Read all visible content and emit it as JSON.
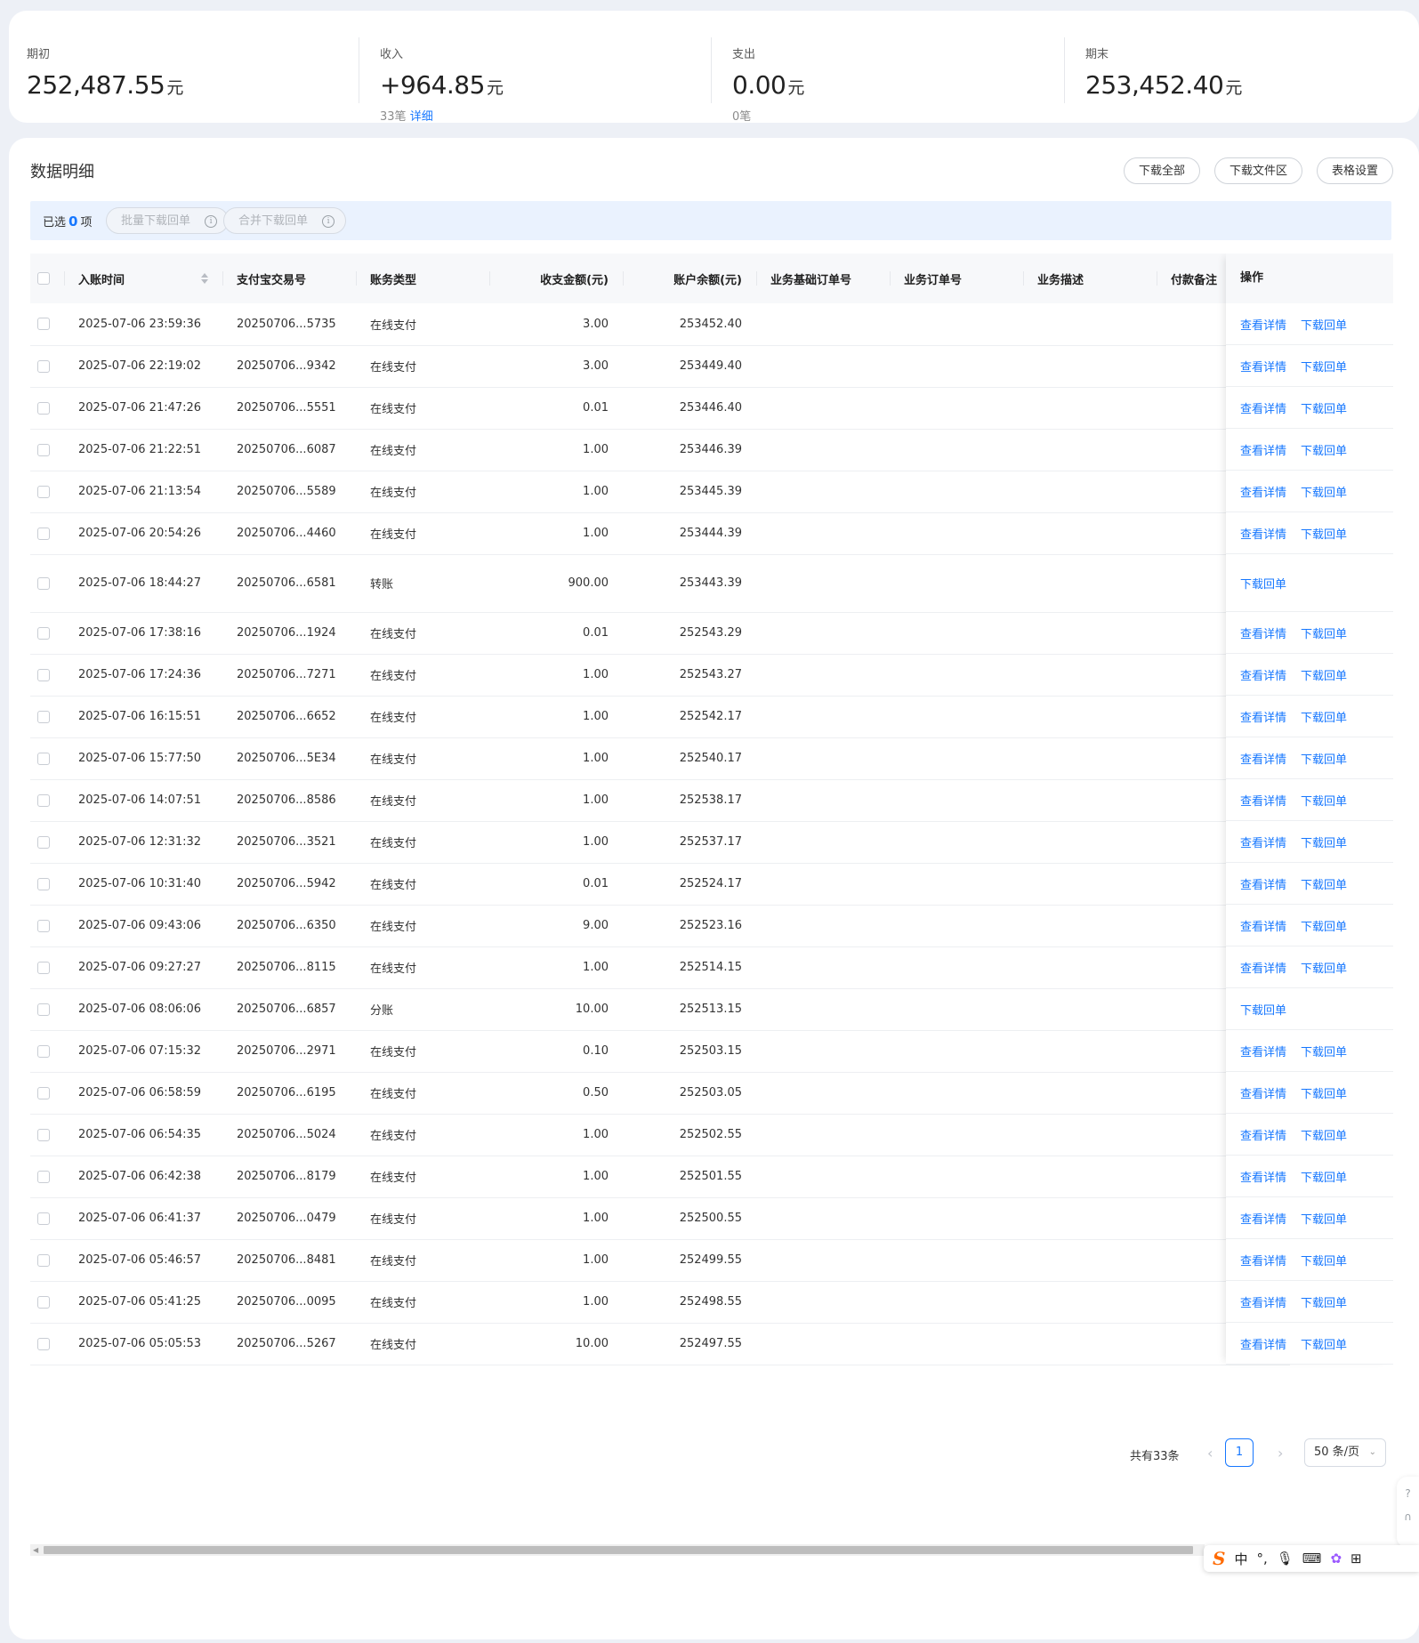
{
  "summary": [
    {
      "label": "期初",
      "value": "252,487.55",
      "unit": "元",
      "count": "",
      "link": ""
    },
    {
      "label": "收入",
      "value": "+964.85",
      "unit": "元",
      "count": "33笔",
      "link": "详细"
    },
    {
      "label": "支出",
      "value": "0.00",
      "unit": "元",
      "count": "0笔",
      "link": ""
    },
    {
      "label": "期末",
      "value": "253,452.40",
      "unit": "元",
      "count": "",
      "link": ""
    }
  ],
  "details": {
    "title": "数据明细",
    "buttons": {
      "download_all": "下载全部",
      "download_area": "下载文件区",
      "table_settings": "表格设置"
    },
    "selection": {
      "prefix": "已选",
      "count": "0",
      "suffix": "项",
      "batch_download": "批量下载回单",
      "merge_download": "合并下载回单"
    }
  },
  "table": {
    "columns": [
      "入账时间",
      "支付宝交易号",
      "账务类型",
      "收支金额(元)",
      "账户余额(元)",
      "业务基础订单号",
      "业务订单号",
      "业务描述",
      "付款备注"
    ],
    "action_header": "操作",
    "action_labels": {
      "view": "查看详情",
      "download": "下载回单"
    },
    "rows": [
      {
        "time": "2025-07-06 23:59:36",
        "trade_no": "20250706...5735",
        "type": "在线支付",
        "amount": "3.00",
        "balance": "253452.40",
        "actions": [
          "查看详情",
          "下载回单"
        ]
      },
      {
        "time": "2025-07-06 22:19:02",
        "trade_no": "20250706...9342",
        "type": "在线支付",
        "amount": "3.00",
        "balance": "253449.40",
        "actions": [
          "查看详情",
          "下载回单"
        ]
      },
      {
        "time": "2025-07-06 21:47:26",
        "trade_no": "20250706...5551",
        "type": "在线支付",
        "amount": "0.01",
        "balance": "253446.40",
        "actions": [
          "查看详情",
          "下载回单"
        ]
      },
      {
        "time": "2025-07-06 21:22:51",
        "trade_no": "20250706...6087",
        "type": "在线支付",
        "amount": "1.00",
        "balance": "253446.39",
        "actions": [
          "查看详情",
          "下载回单"
        ]
      },
      {
        "time": "2025-07-06 21:13:54",
        "trade_no": "20250706...5589",
        "type": "在线支付",
        "amount": "1.00",
        "balance": "253445.39",
        "actions": [
          "查看详情",
          "下载回单"
        ]
      },
      {
        "time": "2025-07-06 20:54:26",
        "trade_no": "20250706...4460",
        "type": "在线支付",
        "amount": "1.00",
        "balance": "253444.39",
        "actions": [
          "查看详情",
          "下载回单"
        ]
      },
      {
        "time": "2025-07-06 18:44:27",
        "trade_no": "20250706...6581",
        "type": "转账",
        "amount": "900.00",
        "balance": "253443.39",
        "actions": [
          "下载回单"
        ],
        "tall": true
      },
      {
        "time": "2025-07-06 17:38:16",
        "trade_no": "20250706...1924",
        "type": "在线支付",
        "amount": "0.01",
        "balance": "252543.29",
        "actions": [
          "查看详情",
          "下载回单"
        ]
      },
      {
        "time": "2025-07-06 17:24:36",
        "trade_no": "20250706...7271",
        "type": "在线支付",
        "amount": "1.00",
        "balance": "252543.27",
        "actions": [
          "查看详情",
          "下载回单"
        ]
      },
      {
        "time": "2025-07-06 16:15:51",
        "trade_no": "20250706...6652",
        "type": "在线支付",
        "amount": "1.00",
        "balance": "252542.17",
        "actions": [
          "查看详情",
          "下载回单"
        ]
      },
      {
        "time": "2025-07-06 15:77:50",
        "trade_no": "20250706...5E34",
        "type": "在线支付",
        "amount": "1.00",
        "balance": "252540.17",
        "actions": [
          "查看详情",
          "下载回单"
        ]
      },
      {
        "time": "2025-07-06 14:07:51",
        "trade_no": "20250706...8586",
        "type": "在线支付",
        "amount": "1.00",
        "balance": "252538.17",
        "actions": [
          "查看详情",
          "下载回单"
        ]
      },
      {
        "time": "2025-07-06 12:31:32",
        "trade_no": "20250706...3521",
        "type": "在线支付",
        "amount": "1.00",
        "balance": "252537.17",
        "actions": [
          "查看详情",
          "下载回单"
        ]
      },
      {
        "time": "2025-07-06 10:31:40",
        "trade_no": "20250706...5942",
        "type": "在线支付",
        "amount": "0.01",
        "balance": "252524.17",
        "actions": [
          "查看详情",
          "下载回单"
        ]
      },
      {
        "time": "2025-07-06 09:43:06",
        "trade_no": "20250706...6350",
        "type": "在线支付",
        "amount": "9.00",
        "balance": "252523.16",
        "actions": [
          "查看详情",
          "下载回单"
        ]
      },
      {
        "time": "2025-07-06 09:27:27",
        "trade_no": "20250706...8115",
        "type": "在线支付",
        "amount": "1.00",
        "balance": "252514.15",
        "actions": [
          "查看详情",
          "下载回单"
        ]
      },
      {
        "time": "2025-07-06 08:06:06",
        "trade_no": "20250706...6857",
        "type": "分账",
        "amount": "10.00",
        "balance": "252513.15",
        "actions": [
          "下载回单"
        ]
      },
      {
        "time": "2025-07-06 07:15:32",
        "trade_no": "20250706...2971",
        "type": "在线支付",
        "amount": "0.10",
        "balance": "252503.15",
        "actions": [
          "查看详情",
          "下载回单"
        ]
      },
      {
        "time": "2025-07-06 06:58:59",
        "trade_no": "20250706...6195",
        "type": "在线支付",
        "amount": "0.50",
        "balance": "252503.05",
        "actions": [
          "查看详情",
          "下载回单"
        ]
      },
      {
        "time": "2025-07-06 06:54:35",
        "trade_no": "20250706...5024",
        "type": "在线支付",
        "amount": "1.00",
        "balance": "252502.55",
        "actions": [
          "查看详情",
          "下载回单"
        ]
      },
      {
        "time": "2025-07-06 06:42:38",
        "trade_no": "20250706...8179",
        "type": "在线支付",
        "amount": "1.00",
        "balance": "252501.55",
        "actions": [
          "查看详情",
          "下载回单"
        ]
      },
      {
        "time": "2025-07-06 06:41:37",
        "trade_no": "20250706...0479",
        "type": "在线支付",
        "amount": "1.00",
        "balance": "252500.55",
        "actions": [
          "查看详情",
          "下载回单"
        ]
      },
      {
        "time": "2025-07-06 05:46:57",
        "trade_no": "20250706...8481",
        "type": "在线支付",
        "amount": "1.00",
        "balance": "252499.55",
        "actions": [
          "查看详情",
          "下载回单"
        ]
      },
      {
        "time": "2025-07-06 05:41:25",
        "trade_no": "20250706...0095",
        "type": "在线支付",
        "amount": "1.00",
        "balance": "252498.55",
        "actions": [
          "查看详情",
          "下载回单"
        ]
      },
      {
        "time": "2025-07-06 05:05:53",
        "trade_no": "20250706...5267",
        "type": "在线支付",
        "amount": "10.00",
        "balance": "252497.55",
        "actions": [
          "查看详情",
          "下载回单"
        ]
      }
    ]
  },
  "pagination": {
    "total": "共有33条",
    "current_page": "1",
    "page_size": "50 条/页",
    "prev_icon": "chevron-left-icon",
    "next_icon": "chevron-right-icon"
  },
  "ime_toolbar": {
    "logo": "S",
    "lang": "中",
    "punct": "°,",
    "icons": [
      "mic-icon",
      "keyboard-icon",
      "skin-icon",
      "grid-icon"
    ]
  },
  "side_float": {
    "icons": [
      "help-icon",
      "headset-icon"
    ]
  },
  "colors": {
    "accent": "#1677ff",
    "page_bg": "#edf0f6",
    "selection_bar": "#eaf2fe"
  }
}
